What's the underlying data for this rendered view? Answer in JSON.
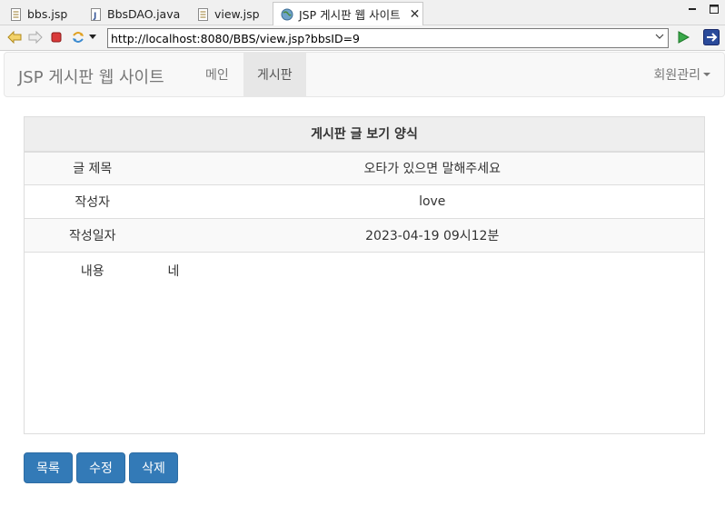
{
  "editor_tabs": [
    {
      "label": "bbs.jsp",
      "icon": "jsp-file-icon"
    },
    {
      "label": "BbsDAO.java",
      "icon": "java-file-icon"
    },
    {
      "label": "view.jsp",
      "icon": "jsp-file-icon"
    },
    {
      "label": "JSP 게시판 웹 사이트",
      "icon": "globe-icon",
      "active": true
    }
  ],
  "browser": {
    "url": "http://localhost:8080/BBS/view.jsp?bbsID=9"
  },
  "navbar": {
    "brand": "JSP 게시판 웹 사이트",
    "items": [
      {
        "label": "메인",
        "active": false
      },
      {
        "label": "게시판",
        "active": true
      }
    ],
    "right_menu": "회원관리"
  },
  "board": {
    "title": "게시판 글 보기 양식",
    "rows": [
      {
        "label": "글 제목",
        "value": "오타가 있으면 말해주세요"
      },
      {
        "label": "작성자",
        "value": "love"
      },
      {
        "label": "작성일자",
        "value": "2023-04-19 09시12분"
      },
      {
        "label": "내용",
        "value": "네"
      }
    ]
  },
  "buttons": {
    "list": "목록",
    "edit": "수정",
    "delete": "삭제"
  },
  "colors": {
    "primary": "#337ab7",
    "navbar_bg": "#f8f8f8"
  }
}
